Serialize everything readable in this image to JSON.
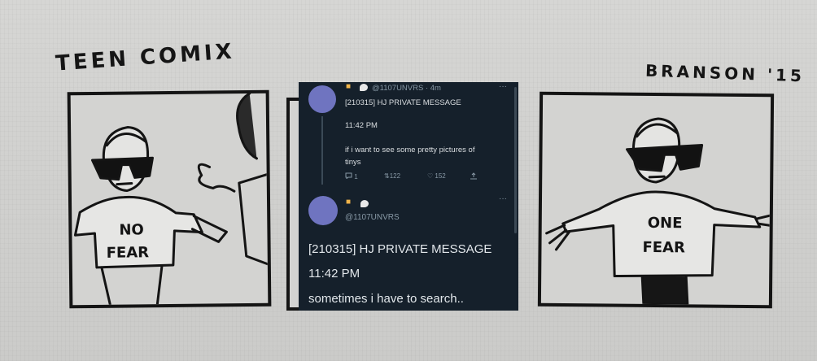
{
  "comic": {
    "title_left": "TEEN COMIX",
    "title_right": "BRANSON '15",
    "shirt_left": [
      "NO",
      "FEAR"
    ],
    "shirt_right": [
      "ONE",
      "FEAR"
    ]
  },
  "tweet1": {
    "handle_time": "@1107UNVRS · 4m",
    "more": "···",
    "line1": "[210315] HJ PRIVATE MESSAGE",
    "line2": "11:42 PM",
    "line3": "if i want to see some pretty pictures of",
    "line4": "tinys",
    "actions": {
      "reply_icon": "reply-icon",
      "reply_count": "1",
      "retweet_icon": "retweet-icon",
      "retweet_count": "122",
      "like_icon": "heart-icon",
      "like_count": "152",
      "share_icon": "share-icon"
    }
  },
  "tweet2": {
    "handle": "@1107UNVRS",
    "more": "···",
    "line1": "[210315] HJ PRIVATE MESSAGE",
    "line2": "11:42 PM",
    "line3": "sometimes i have to search.."
  },
  "colors": {
    "tweet_bg": "#15202b",
    "avatar": "#6f74c0",
    "muted": "#8899a6",
    "ink": "#141414"
  }
}
